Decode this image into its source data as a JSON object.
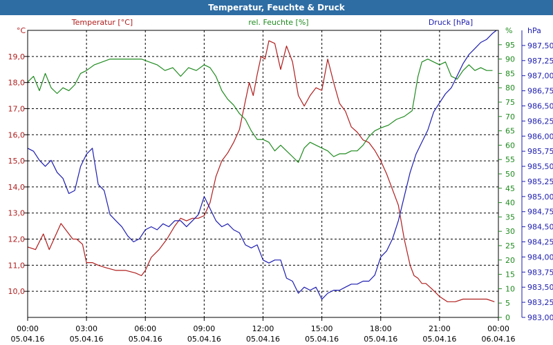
{
  "window": {
    "title": "Temperatur, Feuchte & Druck"
  },
  "chart_data": {
    "type": "line",
    "title": "Temperatur, Feuchte & Druck",
    "x_ticks": [
      {
        "time": "00:00",
        "date": "05.04.16"
      },
      {
        "time": "03:00",
        "date": "05.04.16"
      },
      {
        "time": "06:00",
        "date": "05.04.16"
      },
      {
        "time": "09:00",
        "date": "05.04.16"
      },
      {
        "time": "12:00",
        "date": "05.04.16"
      },
      {
        "time": "15:00",
        "date": "05.04.16"
      },
      {
        "time": "18:00",
        "date": "05.04.16"
      },
      {
        "time": "21:00",
        "date": "05.04.16"
      },
      {
        "time": "00:00",
        "date": "06.04.16"
      }
    ],
    "xlim": [
      0,
      24
    ],
    "grid": true,
    "axes": {
      "temperature": {
        "label": "Temperatur [°C]",
        "unit": "°C",
        "color": "#b01c1c",
        "ylim": [
          9.0,
          20.0
        ],
        "ticks": [
          "10,0",
          "11,0",
          "12,0",
          "13,0",
          "14,0",
          "15,0",
          "16,0",
          "17,0",
          "18,0",
          "19,0"
        ]
      },
      "humidity": {
        "label": "rel. Feuchte [%]",
        "unit": "%",
        "color": "#1f8a1f",
        "ylim": [
          0,
          100
        ],
        "ticks": [
          "0",
          "5",
          "10",
          "15",
          "20",
          "25",
          "30",
          "35",
          "40",
          "45",
          "50",
          "55",
          "60",
          "65",
          "70",
          "75",
          "80",
          "85",
          "90",
          "95"
        ]
      },
      "pressure": {
        "label": "Druck [hPa]",
        "unit": "hPa",
        "color": "#1c1cb0",
        "ylim": [
          983.0,
          987.75
        ],
        "ticks": [
          "983,00",
          "983,25",
          "983,50",
          "983,75",
          "984,00",
          "984,25",
          "984,50",
          "984,75",
          "985,00",
          "985,25",
          "985,50",
          "985,75",
          "986,00",
          "986,25",
          "986,50",
          "986,75",
          "987,00",
          "987,25",
          "987,50"
        ]
      }
    },
    "series": [
      {
        "name": "Temperatur [°C]",
        "axis": "temperature",
        "color": "#b01c1c",
        "x": [
          0,
          0.4,
          0.8,
          1.1,
          1.4,
          1.7,
          2.0,
          2.3,
          2.5,
          2.8,
          3.0,
          3.3,
          3.6,
          4.0,
          4.5,
          5.0,
          5.5,
          5.8,
          6.0,
          6.3,
          6.7,
          7.1,
          7.5,
          7.8,
          8.1,
          8.4,
          8.7,
          9.0,
          9.3,
          9.6,
          9.9,
          10.2,
          10.5,
          10.8,
          11.1,
          11.3,
          11.5,
          11.7,
          11.9,
          12.1,
          12.3,
          12.6,
          12.9,
          13.2,
          13.5,
          13.8,
          14.1,
          14.4,
          14.7,
          15.0,
          15.3,
          15.6,
          15.9,
          16.2,
          16.5,
          16.8,
          17.1,
          17.4,
          17.7,
          18.0,
          18.3,
          18.6,
          18.9,
          19.2,
          19.5,
          19.7,
          19.9,
          20.1,
          20.3,
          20.6,
          21.0,
          21.4,
          21.8,
          22.2,
          22.6,
          23.0,
          23.4,
          23.8
        ],
        "y": [
          11.7,
          11.6,
          12.2,
          11.6,
          12.1,
          12.6,
          12.3,
          12.0,
          12.0,
          11.8,
          11.1,
          11.1,
          11.0,
          10.9,
          10.8,
          10.8,
          10.7,
          10.6,
          10.8,
          11.3,
          11.6,
          12.0,
          12.5,
          12.8,
          12.7,
          12.8,
          12.8,
          12.9,
          13.4,
          14.4,
          15.0,
          15.3,
          15.7,
          16.2,
          17.3,
          18.0,
          17.5,
          18.3,
          19.0,
          18.9,
          19.6,
          19.5,
          18.5,
          19.4,
          18.8,
          17.5,
          17.1,
          17.5,
          17.8,
          17.7,
          18.9,
          18.0,
          17.2,
          16.9,
          16.3,
          16.1,
          15.8,
          15.7,
          15.4,
          15.0,
          14.5,
          13.9,
          13.3,
          12.0,
          11.0,
          10.6,
          10.5,
          10.3,
          10.3,
          10.1,
          9.8,
          9.6,
          9.6,
          9.7,
          9.7,
          9.7,
          9.7,
          9.6
        ]
      },
      {
        "name": "rel. Feuchte [%]",
        "axis": "humidity",
        "color": "#1f8a1f",
        "x": [
          0,
          0.3,
          0.6,
          0.9,
          1.2,
          1.5,
          1.8,
          2.1,
          2.4,
          2.7,
          3.0,
          3.4,
          3.8,
          4.2,
          4.6,
          5.0,
          5.4,
          5.8,
          6.2,
          6.6,
          7.0,
          7.4,
          7.8,
          8.2,
          8.6,
          9.0,
          9.3,
          9.6,
          9.9,
          10.2,
          10.5,
          10.8,
          11.1,
          11.4,
          11.7,
          12.0,
          12.3,
          12.6,
          12.9,
          13.2,
          13.5,
          13.8,
          14.1,
          14.4,
          14.7,
          15.0,
          15.3,
          15.6,
          15.9,
          16.2,
          16.5,
          16.8,
          17.1,
          17.4,
          17.7,
          18.0,
          18.4,
          18.8,
          19.2,
          19.6,
          19.9,
          20.1,
          20.4,
          20.7,
          21.0,
          21.3,
          21.6,
          21.9,
          22.2,
          22.5,
          22.8,
          23.1,
          23.4,
          23.7
        ],
        "y": [
          82,
          84,
          79,
          85,
          80,
          78,
          80,
          79,
          81,
          85,
          86,
          88,
          89,
          90,
          90,
          90,
          90,
          90,
          89,
          88,
          86,
          87,
          84,
          87,
          86,
          88,
          87,
          84,
          79,
          76,
          74,
          71,
          69,
          65,
          62,
          62,
          61,
          58,
          60,
          58,
          56,
          54,
          59,
          61,
          60,
          59,
          58,
          56,
          57,
          57,
          58,
          58,
          60,
          63,
          65,
          66,
          67,
          69,
          70,
          72,
          84,
          89,
          90,
          89,
          88,
          89,
          84,
          83,
          86,
          88,
          86,
          87,
          86,
          86
        ]
      },
      {
        "name": "Druck [hPa]",
        "axis": "pressure",
        "color": "#1c1cb0",
        "x": [
          0,
          0.3,
          0.6,
          0.9,
          1.2,
          1.5,
          1.8,
          2.1,
          2.4,
          2.7,
          3.0,
          3.3,
          3.6,
          3.9,
          4.2,
          4.5,
          4.8,
          5.1,
          5.4,
          5.7,
          6.0,
          6.3,
          6.6,
          6.9,
          7.2,
          7.5,
          7.8,
          8.1,
          8.4,
          8.7,
          9.0,
          9.3,
          9.6,
          9.9,
          10.2,
          10.5,
          10.8,
          11.1,
          11.4,
          11.7,
          12.0,
          12.3,
          12.6,
          12.9,
          13.2,
          13.5,
          13.8,
          14.1,
          14.4,
          14.7,
          15.0,
          15.3,
          15.6,
          15.9,
          16.2,
          16.5,
          16.8,
          17.1,
          17.4,
          17.7,
          18.0,
          18.3,
          18.6,
          18.9,
          19.2,
          19.5,
          19.8,
          20.1,
          20.4,
          20.7,
          21.0,
          21.3,
          21.6,
          21.9,
          22.2,
          22.5,
          22.8,
          23.1,
          23.4,
          23.7,
          23.9
        ],
        "y": [
          985.8,
          985.75,
          985.6,
          985.5,
          985.6,
          985.4,
          985.3,
          985.05,
          985.1,
          985.5,
          985.7,
          985.8,
          985.2,
          985.1,
          984.7,
          984.6,
          984.5,
          984.35,
          984.25,
          984.3,
          984.45,
          984.5,
          984.45,
          984.55,
          984.5,
          984.6,
          984.6,
          984.5,
          984.6,
          984.7,
          985.0,
          984.8,
          984.6,
          984.5,
          984.55,
          984.45,
          984.4,
          984.2,
          984.15,
          984.2,
          983.95,
          983.9,
          983.95,
          983.95,
          983.65,
          983.6,
          983.4,
          983.5,
          983.45,
          983.5,
          983.3,
          983.4,
          983.45,
          983.45,
          983.5,
          983.55,
          983.55,
          983.6,
          983.6,
          983.7,
          984.0,
          984.1,
          984.3,
          984.6,
          985.0,
          985.4,
          985.7,
          985.9,
          986.1,
          986.4,
          986.55,
          986.7,
          986.8,
          987.0,
          987.2,
          987.35,
          987.45,
          987.55,
          987.6,
          987.7,
          987.75
        ]
      }
    ]
  }
}
